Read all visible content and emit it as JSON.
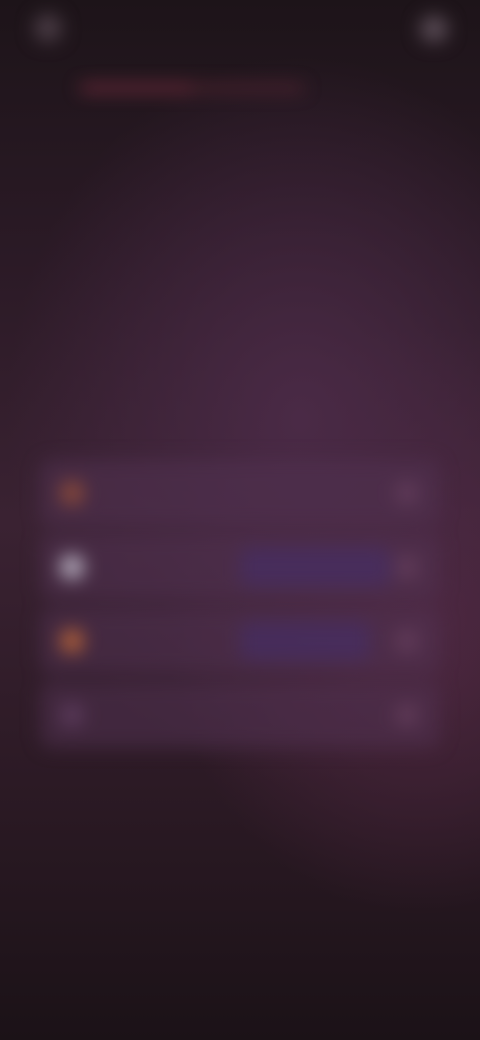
{
  "header": {
    "brand": "",
    "login_label": ""
  },
  "progress": {
    "fraction": 0.5
  },
  "headline": {
    "lines": [
      "",
      "",
      ""
    ]
  },
  "subline": "",
  "options": [
    {
      "label": "",
      "icon": "orange-circle-icon",
      "icon_color": "#8a4a3a"
    },
    {
      "label": "",
      "icon": "white-circle-icon",
      "icon_color": "#b8b0c0"
    },
    {
      "label": "",
      "icon": "orange-circle-icon",
      "icon_color": "#b0603a"
    },
    {
      "label": "",
      "icon": "purple-circle-icon",
      "icon_color": "#5a3a5a"
    }
  ],
  "colors": {
    "accent": "#c0405a",
    "background": "#2b1a26",
    "headline": "#efe6ee"
  }
}
